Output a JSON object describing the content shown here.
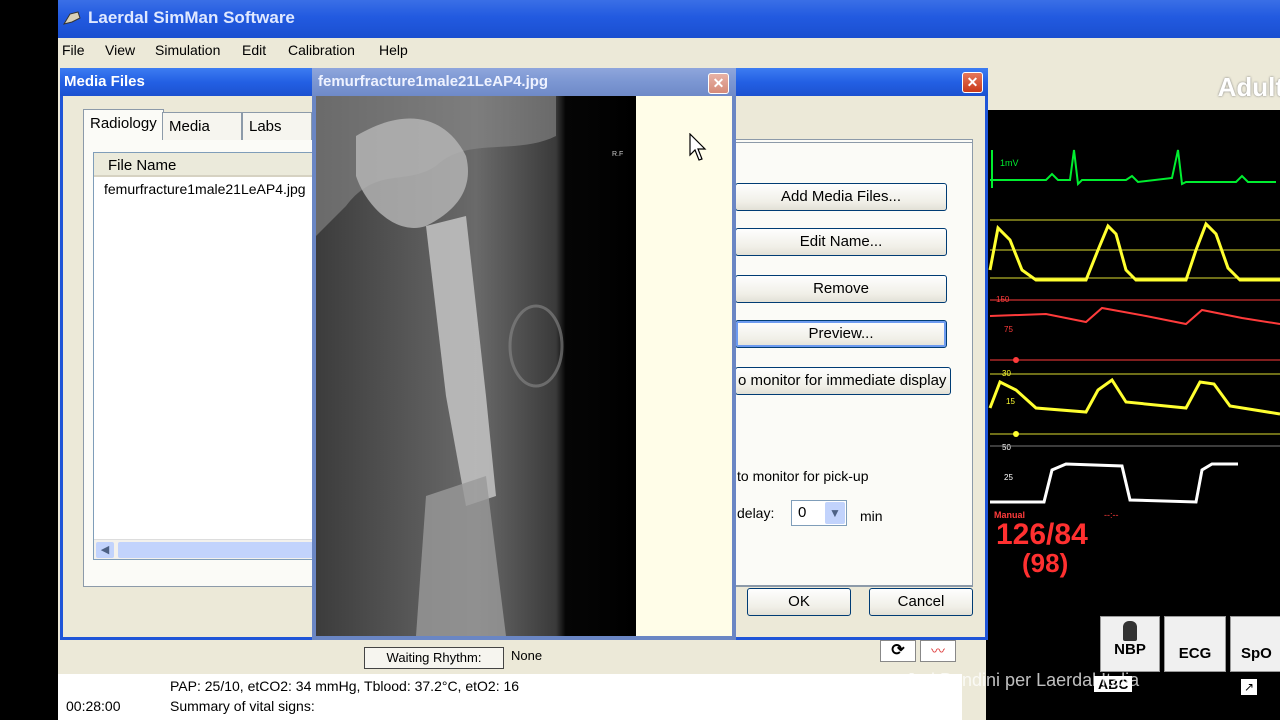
{
  "app": {
    "title": "Laerdal SimMan Software",
    "menu": [
      "File",
      "View",
      "Simulation",
      "Edit",
      "Calibration",
      "Help"
    ]
  },
  "media_dialog": {
    "title": "Media Files",
    "close_glyph": "✕",
    "tabs": [
      "Radiology",
      "Media",
      "Labs"
    ],
    "active_tab": "Radiology",
    "column_header": "File Name",
    "files": [
      "femurfracture1male21LeAP4.jpg"
    ],
    "buttons": {
      "add": "Add Media Files...",
      "edit": "Edit Name...",
      "remove": "Remove",
      "preview": "Preview...",
      "send_now": "o monitor for immediate display",
      "ok": "OK",
      "cancel": "Cancel"
    },
    "pickup_label": "to monitor for pick-up",
    "delay_label": "delay:",
    "delay_value": "0",
    "delay_unit": "min"
  },
  "viewer": {
    "title": "femurfracture1male21LeAP4.jpg",
    "close_glyph": "✕",
    "image_marker": "R.F"
  },
  "monitor": {
    "header": "Adult",
    "ecg_scale": "1mV",
    "abp_scale": "150",
    "abp_mid": "75",
    "pap_scale": "30",
    "pap_mid": "15",
    "co2_scale": "50",
    "co2_mid": "25",
    "nbp_mode": "Manual",
    "nbp_time": "--:--",
    "nbp_value": "126/84",
    "nbp_mean": "(98)",
    "buttons": [
      "NBP",
      "ECG",
      "SpO"
    ],
    "abc_label": "ABC",
    "colors": {
      "ecg": "#00ee30",
      "abp": "#ffff30",
      "red": "#ff3b3b",
      "co2": "#ffffff"
    }
  },
  "log": {
    "waiting_button": "Waiting Rhythm:",
    "rhythm_value": "None",
    "line1": "PAP: 25/10, etCO2: 34 mmHg, Tblood: 37.2°C,  etO2: 16",
    "time": "00:28:00",
    "line2": "Summary of vital signs:"
  },
  "watermark": "Juri Bendini  per Laerdal Italia"
}
